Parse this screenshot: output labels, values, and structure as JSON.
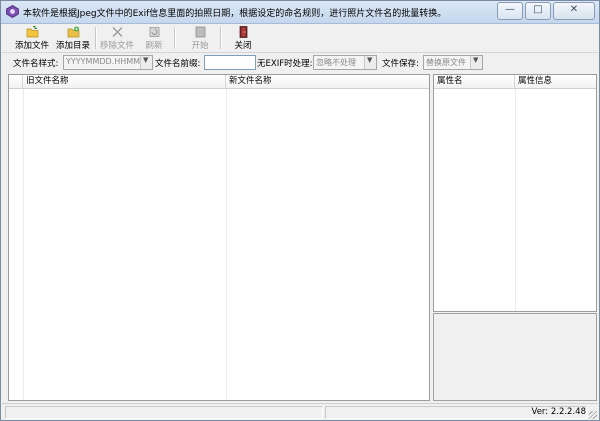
{
  "window": {
    "title": "本软件是根据Jpeg文件中的Exif信息里面的拍照日期，根据设定的命名规则，进行照片文件名的批量转换。",
    "controls": {
      "minimize": "—",
      "maximize": "□",
      "close": "✕"
    }
  },
  "toolbar": {
    "add_file": "添加文件",
    "add_folder": "添加目录",
    "remove_file": "移除文件",
    "refresh": "刷新",
    "start": "开始",
    "close": "关闭"
  },
  "options": {
    "name_style_label": "文件名样式:",
    "name_style_value": "YYYYMMDD.HHMMSS",
    "prefix_label": "文件名前缀:",
    "prefix_value": "",
    "no_exif_label": "无EXIF时处理:",
    "no_exif_value": "忽略不处理",
    "save_label": "文件保存:",
    "save_value": "替换原文件"
  },
  "file_list": {
    "columns": [
      "旧文件名称",
      "新文件名称"
    ],
    "rows": []
  },
  "properties": {
    "columns": [
      "属性名",
      "属性信息"
    ],
    "rows": []
  },
  "status": {
    "version": "Ver: 2.2.2.48"
  },
  "colors": {
    "window_border": "#7a8ca3",
    "titlebar": "#c4d7ee",
    "face": "#f0f0f0"
  }
}
